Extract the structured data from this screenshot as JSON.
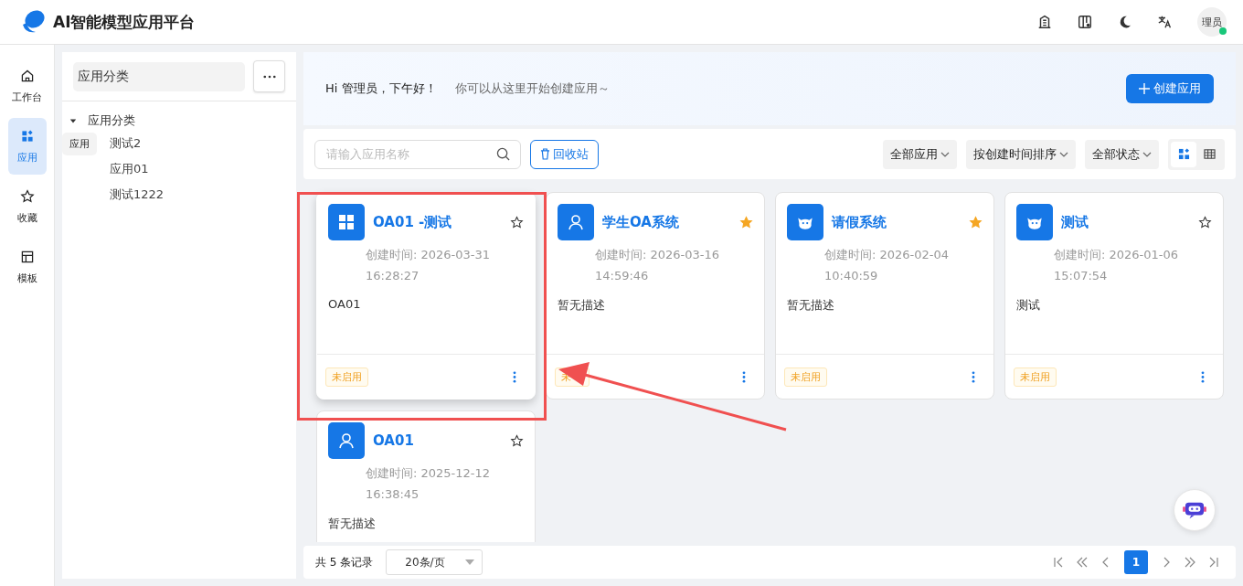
{
  "header": {
    "title": "AI智能模型应用平台",
    "avatar": "理员",
    "online": true
  },
  "nav": [
    {
      "label": "工作台",
      "kind": "home",
      "selected": false
    },
    {
      "label": "应用",
      "kind": "apps",
      "selected": true
    },
    {
      "label": "收藏",
      "kind": "star",
      "selected": false
    },
    {
      "label": "模板",
      "kind": "template",
      "selected": false
    }
  ],
  "category_panel": {
    "title": "应用分类",
    "tree": [
      {
        "label": "应用分类",
        "expanded": true,
        "children": [
          {
            "label": "测试2"
          },
          {
            "label": "应用01"
          },
          {
            "label": "测试1222"
          }
        ]
      }
    ],
    "tooltip": "应用"
  },
  "banner": {
    "greeting": "Hi 管理员，下午好！",
    "subtitle": "你可以从这里开始创建应用～",
    "create_button": "创建应用"
  },
  "toolbar": {
    "search": {
      "placeholder": "请输入应用名称"
    },
    "recycle_button": "回收站",
    "filters": [
      "全部应用",
      "按创建时间排序",
      "全部状态"
    ],
    "views": [
      {
        "kind": "grid",
        "selected": true
      },
      {
        "kind": "table",
        "selected": false
      }
    ]
  },
  "apps": [
    {
      "name": "OA01 -测试",
      "kind": "grid",
      "favorite": false,
      "hovered": true,
      "created": "创建时间: 2026-03-31 16:28:27",
      "description": "OA01",
      "status": "未启用"
    },
    {
      "name": "学生OA系统",
      "kind": "person",
      "favorite": true,
      "hovered": false,
      "created": "创建时间: 2026-03-16 14:59:46",
      "description": "暂无描述",
      "status": "未"
    },
    {
      "name": "请假系统",
      "kind": "mascot",
      "favorite": true,
      "hovered": false,
      "created": "创建时间: 2026-02-04 10:40:59",
      "description": "暂无描述",
      "status": "未启用"
    },
    {
      "name": "测试",
      "kind": "mascot",
      "favorite": false,
      "hovered": false,
      "created": "创建时间: 2026-01-06 15:07:54",
      "description": "测试",
      "status": "未启用"
    },
    {
      "name": "OA01",
      "kind": "person",
      "favorite": false,
      "hovered": false,
      "created": "创建时间: 2025-12-12 16:38:45",
      "description": "暂无描述"
    }
  ],
  "pagination": {
    "total": "共 5 条记录",
    "page_size": "20条/页",
    "pages": [
      {
        "label": "1",
        "selected": true
      }
    ]
  }
}
